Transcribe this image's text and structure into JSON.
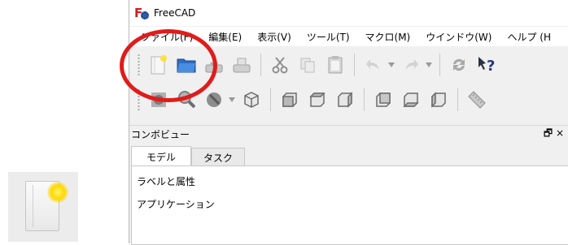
{
  "app": {
    "title": "FreeCAD"
  },
  "menu": [
    "ファイル(F)",
    "編集(E)",
    "表示(V)",
    "ツール(T)",
    "マクロ(M)",
    "ウインドウ(W)",
    "ヘルプ (H"
  ],
  "combo": {
    "title": "コンボビュー",
    "tabs": [
      "モデル",
      "タスク"
    ],
    "tree_header": "ラベルと属性",
    "tree_item": "アプリケーション",
    "window_controls": "🗗 ×"
  },
  "icons": {
    "toolbar1": [
      "new-document-icon",
      "open-icon",
      "save-icon",
      "save-as-icon",
      "cut-icon",
      "copy-icon",
      "paste-icon",
      "undo-icon",
      "redo-icon",
      "refresh-icon",
      "whats-this-icon"
    ],
    "toolbar2": [
      "sketch-view-icon",
      "zoom-icon",
      "draw-style-icon",
      "isometric-icon",
      "front-view-icon",
      "top-view-icon",
      "right-view-icon",
      "rear-view-icon",
      "bottom-view-icon",
      "left-view-icon",
      "measure-icon"
    ]
  },
  "colors": {
    "highlight": "#e11b1b",
    "accent": "#ffd800"
  }
}
